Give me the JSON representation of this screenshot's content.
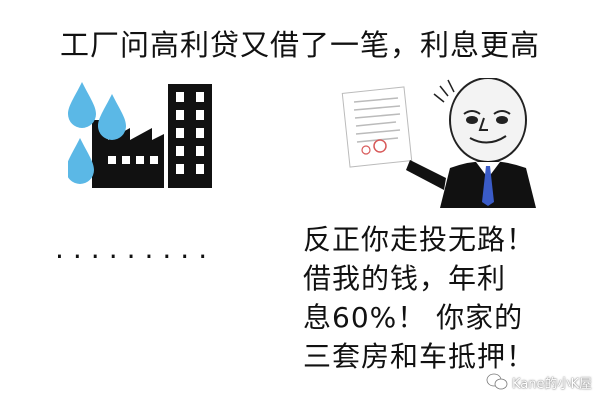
{
  "title": "工厂问高利贷又借了一笔，利息更高",
  "icons": {
    "factory": "factory-with-water-drops-icon",
    "document": "contract-document-icon",
    "character": "meme-face-character",
    "watermark": "wechat-icon"
  },
  "colors": {
    "water": "#5bb8e6",
    "ink": "#111111",
    "tie": "#3a5bc7"
  },
  "left_panel": {
    "dots": "........."
  },
  "right_panel": {
    "lines": [
      "反正你走投无路！",
      "借我的钱，年利",
      "息60%！  你家的",
      "三套房和车抵押！"
    ]
  },
  "watermark": {
    "text": "Kane的小K屋"
  }
}
